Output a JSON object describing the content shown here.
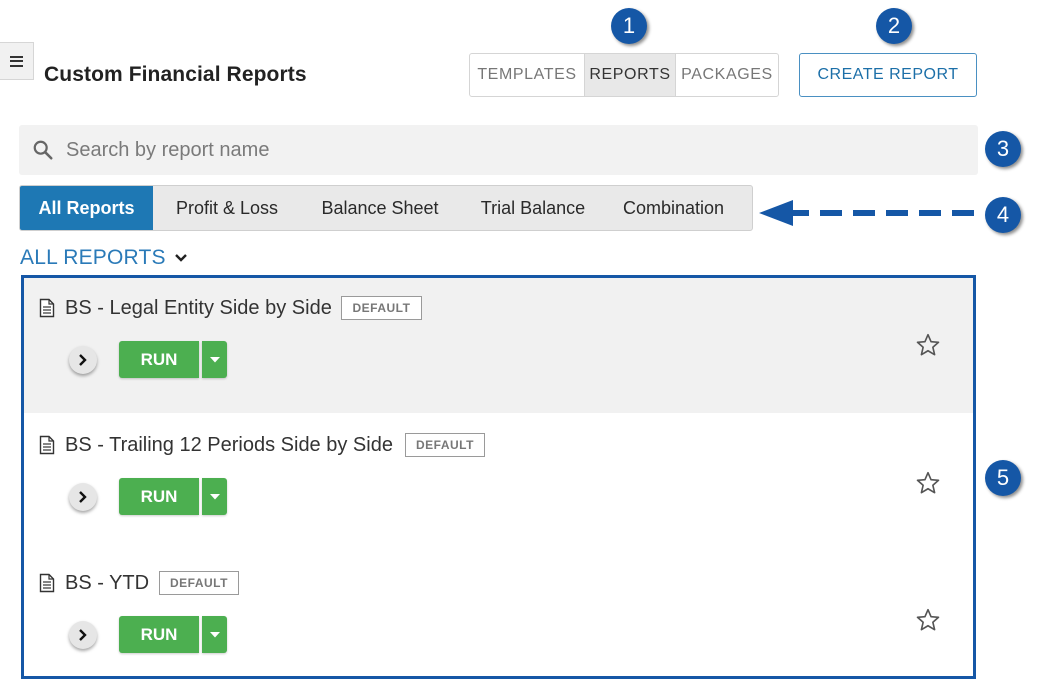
{
  "page": {
    "title": "Custom Financial Reports"
  },
  "view_toggle": {
    "items": [
      "TEMPLATES",
      "REPORTS",
      "PACKAGES"
    ],
    "active": "REPORTS"
  },
  "create_button": {
    "label": "CREATE REPORT"
  },
  "search": {
    "placeholder": "Search by report name",
    "value": ""
  },
  "filter_tabs": {
    "items": [
      "All Reports",
      "Profit & Loss",
      "Balance Sheet",
      "Trial Balance",
      "Combination"
    ],
    "active": "All Reports"
  },
  "list_header": {
    "label": "ALL REPORTS"
  },
  "reports": [
    {
      "name": "BS - Legal Entity Side by Side",
      "badge": "DEFAULT",
      "run_label": "RUN",
      "highlighted": true
    },
    {
      "name": "BS - Trailing 12 Periods Side by Side",
      "badge": "DEFAULT",
      "run_label": "RUN",
      "highlighted": false
    },
    {
      "name": "BS - YTD",
      "badge": "DEFAULT",
      "run_label": "RUN",
      "highlighted": false
    }
  ],
  "callouts": [
    "1",
    "2",
    "3",
    "4",
    "5"
  ],
  "colors": {
    "accent_blue": "#1e78b4",
    "callout_blue": "#1557a6",
    "run_green": "#4caf50",
    "link_blue": "#2a7ab8"
  }
}
